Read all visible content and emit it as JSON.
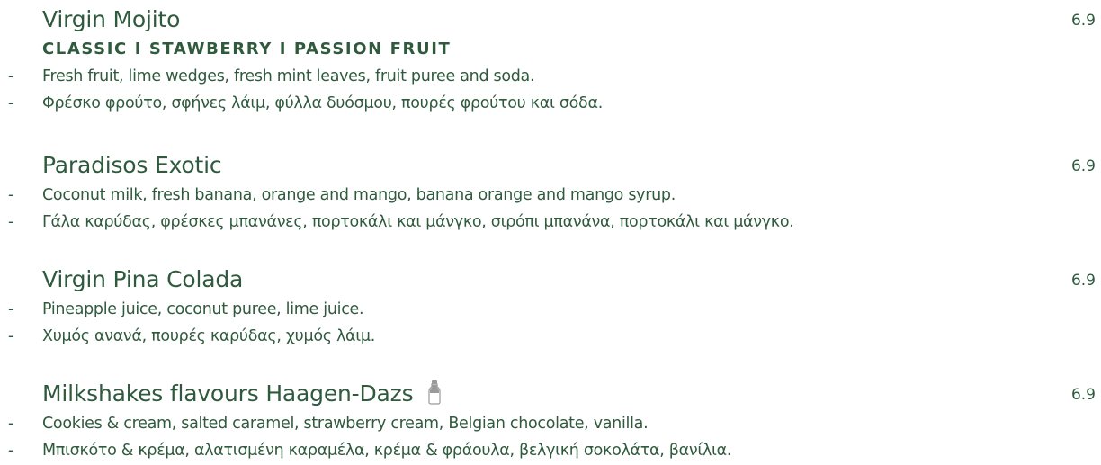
{
  "menu": {
    "items": [
      {
        "name": "Virgin Mojito",
        "price": "6.9",
        "subtitle": "CLASSIC I STAWBERRY I PASSION FRUIT",
        "desc_en": "Fresh fruit, lime wedges, fresh mint leaves, fruit puree and soda.",
        "desc_gr": "Φρέσκο φρούτο, σφήνες λάιμ, φύλλα δυόσμου, πουρές φρούτου και σόδα."
      },
      {
        "name": "Paradisos Exotic",
        "price": "6.9",
        "desc_en": "Coconut milk, fresh banana, orange and mango, banana orange and mango syrup.",
        "desc_gr": "Γάλα καρύδας, φρέσκες μπανάνες, πορτοκάλι και μάνγκο, σιρόπι μπανάνα, πορτοκάλι και μάνγκο."
      },
      {
        "name": "Virgin Pina Colada",
        "price": "6.9",
        "desc_en": "Pineapple juice, coconut puree, lime juice.",
        "desc_gr": "Χυμός ανανά, πουρές καρύδας, χυμός λάιμ."
      },
      {
        "name": "Milkshakes flavours Haagen-Dazs",
        "price": "6.9",
        "icon": "milk-bottle-icon",
        "desc_en": "Cookies & cream, salted caramel, strawberry cream, Belgian chocolate, vanilla.",
        "desc_gr": "Μπισκότο & κρέμα, αλατισμένη καραμέλα, κρέμα & φράουλα, βελγική σοκολάτα, βανίλια."
      }
    ],
    "bullet": "-"
  },
  "colors": {
    "text": "#2f5a3d",
    "background": "#ffffff"
  }
}
